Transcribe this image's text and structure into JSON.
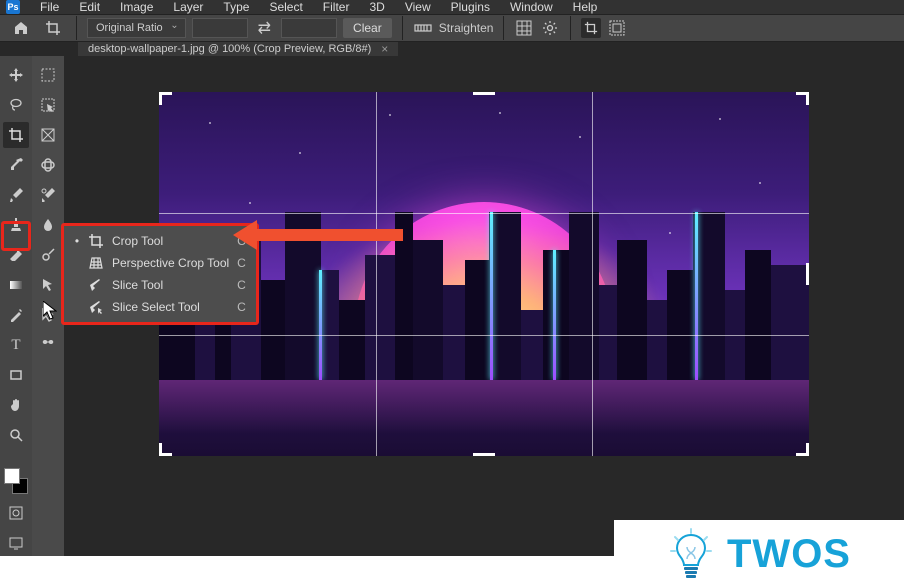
{
  "menubar": {
    "items": [
      "File",
      "Edit",
      "Image",
      "Layer",
      "Type",
      "Select",
      "Filter",
      "3D",
      "View",
      "Plugins",
      "Window",
      "Help"
    ]
  },
  "optionsbar": {
    "ratio_label": "Original Ratio",
    "clear_label": "Clear",
    "straighten_label": "Straighten"
  },
  "tab": {
    "title": "desktop-wallpaper-1.jpg @ 100% (Crop Preview, RGB/8#)"
  },
  "flyout": {
    "items": [
      {
        "label": "Crop Tool",
        "key": "C",
        "active": true
      },
      {
        "label": "Perspective Crop Tool",
        "key": "C",
        "active": false
      },
      {
        "label": "Slice Tool",
        "key": "C",
        "active": false
      },
      {
        "label": "Slice Select Tool",
        "key": "C",
        "active": false
      }
    ]
  },
  "tools_left": [
    "move",
    "lasso",
    "crop",
    "eyedropper",
    "brush",
    "stamp",
    "eraser",
    "paint-bucket",
    "pen",
    "text",
    "shape",
    "hand",
    "zoom"
  ],
  "tools_right": [
    "marquee",
    "magic-wand",
    "frame",
    "heal",
    "history-brush",
    "gradient",
    "blur",
    "dodge",
    "path-select",
    "rectangle",
    "hand",
    "zoom-alt"
  ],
  "watermark": {
    "text": "TWOS"
  }
}
